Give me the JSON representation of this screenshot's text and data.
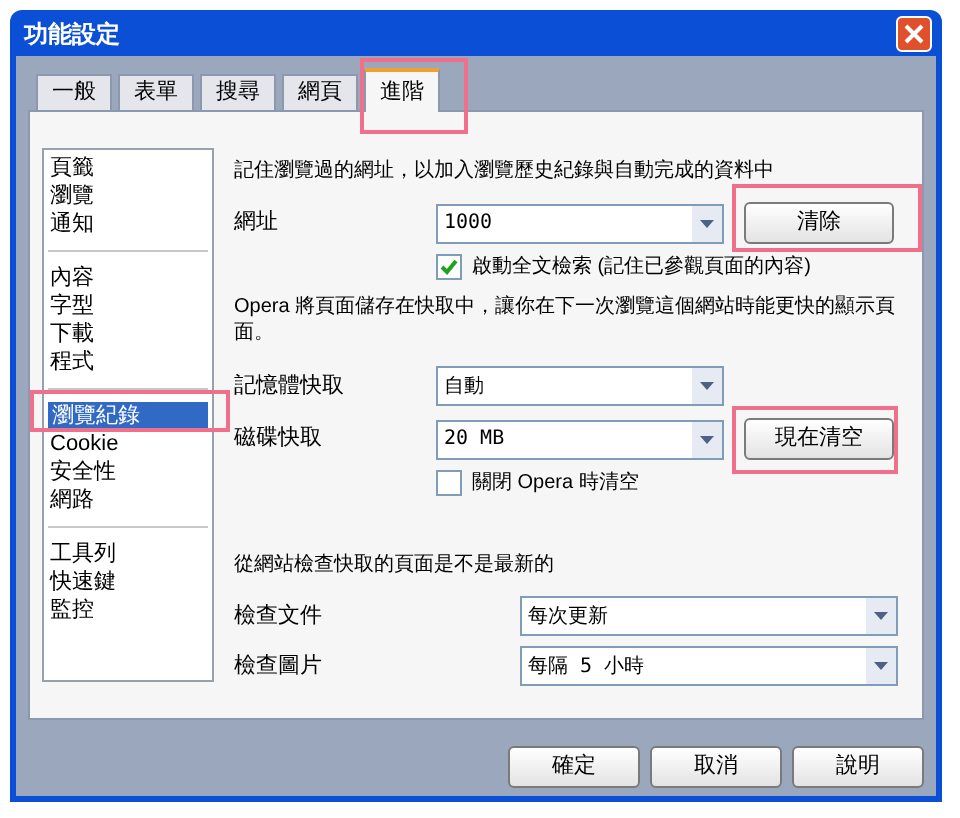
{
  "window": {
    "title": "功能設定"
  },
  "tabs": [
    {
      "label": "一般",
      "selected": false
    },
    {
      "label": "表單",
      "selected": false
    },
    {
      "label": "搜尋",
      "selected": false
    },
    {
      "label": "網頁",
      "selected": false
    },
    {
      "label": "進階",
      "selected": true
    }
  ],
  "sidebar": {
    "groups": [
      [
        {
          "label": "頁籤",
          "selected": false
        },
        {
          "label": "瀏覽",
          "selected": false
        },
        {
          "label": "通知",
          "selected": false
        }
      ],
      [
        {
          "label": "內容",
          "selected": false
        },
        {
          "label": "字型",
          "selected": false
        },
        {
          "label": "下載",
          "selected": false
        },
        {
          "label": "程式",
          "selected": false
        }
      ],
      [
        {
          "label": "瀏覽紀錄",
          "selected": true
        },
        {
          "label": "Cookie",
          "selected": false
        },
        {
          "label": "安全性",
          "selected": false
        },
        {
          "label": "網路",
          "selected": false
        }
      ],
      [
        {
          "label": "工具列",
          "selected": false
        },
        {
          "label": "快速鍵",
          "selected": false
        },
        {
          "label": "監控",
          "selected": false
        }
      ]
    ]
  },
  "history": {
    "description": "記住瀏覽過的網址，以加入瀏覽歷史紀錄與自動完成的資料中",
    "address_label": "網址",
    "address_value": "1000",
    "clear_button": "清除",
    "fulltext_checkbox": {
      "label": "啟動全文檢索 (記住已參觀頁面的內容)",
      "checked": true
    }
  },
  "cache": {
    "description": "Opera 將頁面儲存在快取中，讓你在下一次瀏覽這個網站時能更快的顯示頁面。",
    "memory_label": "記憶體快取",
    "memory_value": "自動",
    "disk_label": "磁碟快取",
    "disk_value": "20 MB",
    "clear_now_button": "現在清空",
    "clear_on_exit_checkbox": {
      "label": "關閉 Opera 時清空",
      "checked": false
    }
  },
  "check": {
    "description": "從網站檢查快取的頁面是不是最新的",
    "documents_label": "檢查文件",
    "documents_value": "每次更新",
    "images_label": "檢查圖片",
    "images_value": "每隔 5 小時"
  },
  "buttons": [
    "確定",
    "取消",
    "說明"
  ]
}
